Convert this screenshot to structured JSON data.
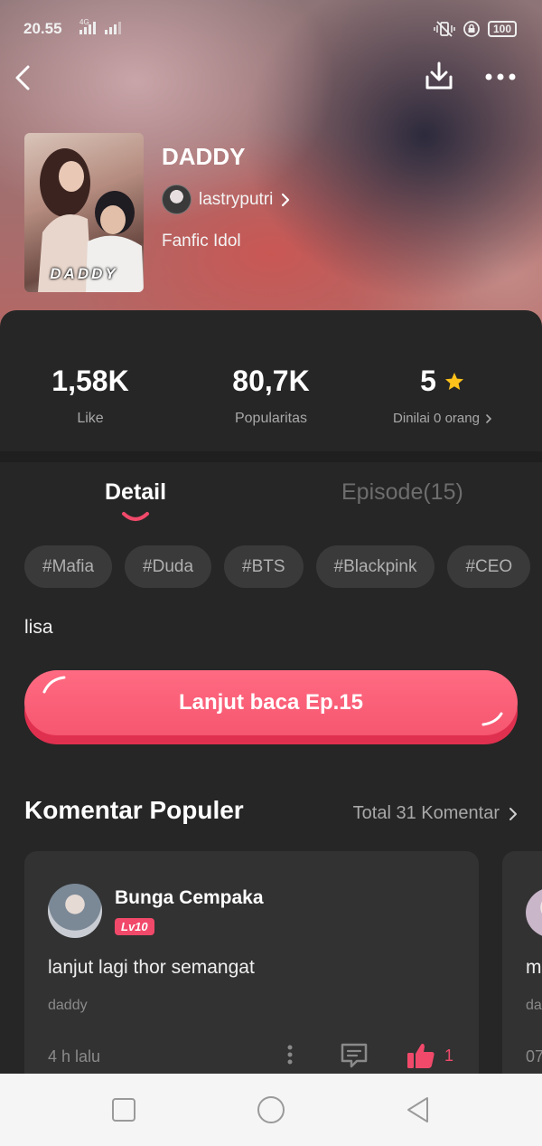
{
  "status_bar": {
    "time": "20.55",
    "network_label": "4G",
    "battery": "100"
  },
  "book": {
    "title": "DADDY",
    "cover_title": "DADDY",
    "author": "lastryputri",
    "genre": "Fanfic Idol"
  },
  "stats": {
    "likes_value": "1,58K",
    "likes_label": "Like",
    "popularity_value": "80,7K",
    "popularity_label": "Popularitas",
    "rating_value": "5",
    "rating_label": "Dinilai 0 orang"
  },
  "tabs": {
    "detail": "Detail",
    "episodes": "Episode(15)"
  },
  "tags": [
    "#Mafia",
    "#Duda",
    "#BTS",
    "#Blackpink",
    "#CEO"
  ],
  "description": "lisa",
  "cta_label": "Lanjut baca Ep.15",
  "comments": {
    "title": "Komentar Populer",
    "total": "Total 31 Komentar",
    "items": [
      {
        "name": "Bunga Cempaka",
        "level": "Lv10",
        "text": "lanjut lagi thor semangat",
        "source": "daddy",
        "time": "4 h lalu",
        "likes": "1"
      },
      {
        "text": "m",
        "source": "da",
        "time": "07"
      }
    ]
  },
  "colors": {
    "accent": "#f1496a",
    "star": "#ffc21a",
    "background": "#262626"
  },
  "icons": [
    "back-icon",
    "download-icon",
    "more-icon",
    "chevron-right-icon",
    "star-icon",
    "comment-icon",
    "thumbs-up-icon",
    "recents-icon",
    "home-icon",
    "back-triangle-icon"
  ]
}
